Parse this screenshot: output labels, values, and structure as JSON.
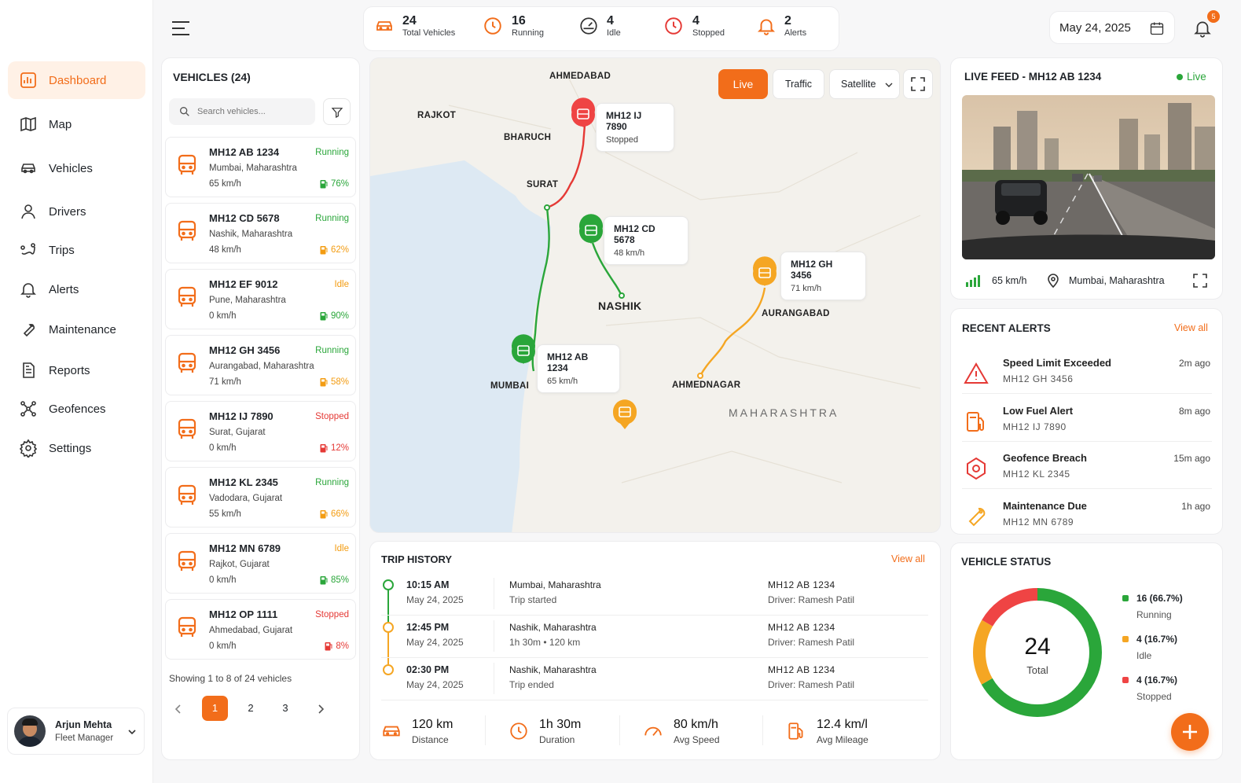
{
  "sidebar": {
    "items": [
      {
        "label": "Dashboard",
        "icon": "dashboard-icon"
      },
      {
        "label": "Map",
        "icon": "map-icon"
      },
      {
        "label": "Vehicles",
        "icon": "car-icon"
      },
      {
        "label": "Drivers",
        "icon": "user-icon"
      },
      {
        "label": "Trips",
        "icon": "route-icon"
      },
      {
        "label": "Alerts",
        "icon": "bell-icon"
      },
      {
        "label": "Maintenance",
        "icon": "wrench-icon"
      },
      {
        "label": "Reports",
        "icon": "document-icon"
      },
      {
        "label": "Geofences",
        "icon": "geofence-icon"
      },
      {
        "label": "Settings",
        "icon": "gear-icon"
      }
    ],
    "user": {
      "name": "Arjun Mehta",
      "role": "Fleet Manager"
    }
  },
  "topbar": {
    "stats": [
      {
        "value": "24",
        "label": "Total Vehicles",
        "icon": "car-icon"
      },
      {
        "value": "16",
        "label": "Running",
        "icon": "clock-icon"
      },
      {
        "value": "4",
        "label": "Idle",
        "icon": "speedometer-icon"
      },
      {
        "value": "4",
        "label": "Stopped",
        "icon": "clock-icon"
      },
      {
        "value": "2",
        "label": "Alerts",
        "icon": "bell-icon"
      }
    ],
    "date": "May 24, 2025",
    "notification_count": "5",
    "accent": "#f26d1a"
  },
  "vehicles": {
    "title": "VEHICLES (24)",
    "search_placeholder": "Search vehicles...",
    "list": [
      {
        "plate": "MH12 AB 1234",
        "location": "Mumbai, Maharashtra",
        "speed": "65 km/h",
        "status": "Running",
        "fuel": "76%"
      },
      {
        "plate": "MH12 CD 5678",
        "location": "Nashik, Maharashtra",
        "speed": "48 km/h",
        "status": "Running",
        "fuel": "62%"
      },
      {
        "plate": "MH12 EF 9012",
        "location": "Pune, Maharashtra",
        "speed": "0 km/h",
        "status": "Idle",
        "fuel": "90%"
      },
      {
        "plate": "MH12 GH 3456",
        "location": "Aurangabad, Maharashtra",
        "speed": "71 km/h",
        "status": "Running",
        "fuel": "58%"
      },
      {
        "plate": "MH12 IJ 7890",
        "location": "Surat, Gujarat",
        "speed": "0 km/h",
        "status": "Stopped",
        "fuel": "12%"
      },
      {
        "plate": "MH12 KL 2345",
        "location": "Vadodara, Gujarat",
        "speed": "55 km/h",
        "status": "Running",
        "fuel": "66%"
      },
      {
        "plate": "MH12 MN 6789",
        "location": "Rajkot, Gujarat",
        "speed": "0 km/h",
        "status": "Idle",
        "fuel": "85%"
      },
      {
        "plate": "MH12 OP 1111",
        "location": "Ahmedabad, Gujarat",
        "speed": "0 km/h",
        "status": "Stopped",
        "fuel": "8%"
      }
    ],
    "showing": "Showing 1 to 8 of 24 vehicles",
    "pages": [
      "1",
      "2",
      "3"
    ],
    "current_page": "1"
  },
  "map": {
    "buttons": {
      "live": "Live",
      "traffic": "Traffic",
      "satellite": "Satellite"
    },
    "cities": [
      "AHMEDABAD",
      "RAJKOT",
      "BHARUCH",
      "SURAT",
      "NASHIK",
      "AURANGABAD",
      "MUMBAI",
      "AHMEDNAGAR",
      "MAHARASHTRA"
    ],
    "labels": [
      {
        "plate": "MH12 IJ 7890",
        "sub": "Stopped"
      },
      {
        "plate": "MH12 CD 5678",
        "sub": "48 km/h"
      },
      {
        "plate": "MH12 GH 3456",
        "sub": "71 km/h"
      },
      {
        "plate": "MH12 AB 1234",
        "sub": "65 km/h"
      }
    ]
  },
  "live_feed": {
    "title": "LIVE FEED - MH12 AB 1234",
    "status": "Live",
    "speed": "65 km/h",
    "location": "Mumbai, Maharashtra"
  },
  "alerts": {
    "title": "RECENT ALERTS",
    "view_all": "View all",
    "items": [
      {
        "title": "Speed Limit Exceeded",
        "plate": "MH12 GH 3456",
        "ago": "2m ago",
        "icon": "warning-icon"
      },
      {
        "title": "Low Fuel Alert",
        "plate": "MH12 IJ 7890",
        "ago": "8m ago",
        "icon": "fuel-icon"
      },
      {
        "title": "Geofence Breach",
        "plate": "MH12 KL 2345",
        "ago": "15m ago",
        "icon": "geofence-icon"
      },
      {
        "title": "Maintenance Due",
        "plate": "MH12 MN 6789",
        "ago": "1h ago",
        "icon": "wrench-icon"
      }
    ]
  },
  "trip": {
    "title": "TRIP HISTORY",
    "view_all": "View all",
    "rows": [
      {
        "time": "10:15 AM",
        "date": "May 24, 2025",
        "place": "Mumbai, Maharashtra",
        "detail": "Trip started",
        "plate": "MH12 AB 1234",
        "driver": "Driver: Ramesh Patil"
      },
      {
        "time": "12:45 PM",
        "date": "May 24, 2025",
        "place": "Nashik, Maharashtra",
        "detail": "1h 30m • 120 km",
        "plate": "MH12 AB 1234",
        "driver": "Driver: Ramesh Patil"
      },
      {
        "time": "02:30 PM",
        "date": "May 24, 2025",
        "place": "Nashik, Maharashtra",
        "detail": "Trip ended",
        "plate": "MH12 AB 1234",
        "driver": "Driver: Ramesh Patil"
      }
    ],
    "summary": [
      {
        "value": "120 km",
        "label": "Distance",
        "icon": "car-icon"
      },
      {
        "value": "1h 30m",
        "label": "Duration",
        "icon": "clock-icon"
      },
      {
        "value": "80 km/h",
        "label": "Avg Speed",
        "icon": "speedometer-icon"
      },
      {
        "value": "12.4 km/l",
        "label": "Avg Mileage",
        "icon": "fuel-icon"
      }
    ]
  },
  "status": {
    "title": "VEHICLE STATUS",
    "total": "24",
    "total_label": "Total",
    "legend": [
      {
        "value": "16 (66.7%)",
        "label": "Running",
        "color": "#2aa63a"
      },
      {
        "value": "4 (16.7%)",
        "label": "Idle",
        "color": "#f5a623"
      },
      {
        "value": "4 (16.7%)",
        "label": "Stopped",
        "color": "#ef4444"
      }
    ],
    "fractions": [
      0.667,
      0.167,
      0.167
    ]
  }
}
